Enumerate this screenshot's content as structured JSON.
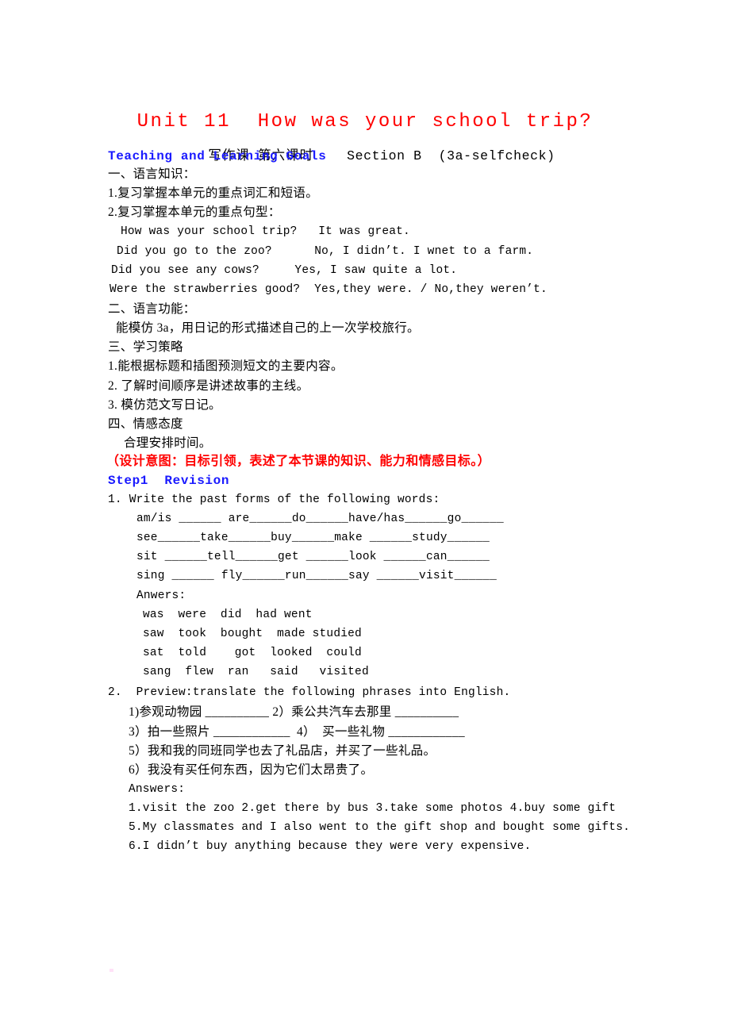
{
  "document": {
    "title": "Unit 11  How was your school trip?",
    "subtitle_cn": "写作课  第六课时",
    "subtitle_en": "Section B  (3a-selfcheck)",
    "colors": {
      "title_red": "#ff0000",
      "heading_blue": "#1a1aff",
      "design_intent_red": "#ff0000",
      "body_black": "#000000",
      "page_background": "#ffffff"
    }
  },
  "goals": {
    "heading": "Teaching and Learning Goals",
    "section_one_title": "一、语言知识：",
    "item_1": "1.复习掌握本单元的重点词汇和短语。",
    "item_2": "2.复习掌握本单元的重点句型：",
    "sentence_1": "How was your school trip?   It was great.",
    "sentence_2": "Did you go to the zoo?      No, I didn’t. I wnet to a farm.",
    "sentence_3": "Did you see any cows?     Yes, I saw quite a lot.",
    "sentence_4": "Were the strawberries good?  Yes,they were. / No,they weren’t.",
    "section_two_title": "二、语言功能：",
    "section_two_body": "能模仿 3a，用日记的形式描述自己的上一次学校旅行。",
    "section_three_title": "三、学习策略",
    "strategy_1": "1.能根据标题和插图预测短文的主要内容。",
    "strategy_2": "2. 了解时间顺序是讲述故事的主线。",
    "strategy_3": "3. 模仿范文写日记。",
    "section_four_title": "四、情感态度",
    "section_four_body": "合理安排时间。",
    "design_intent": "（设计意图：目标引领，表述了本节课的知识、能力和情感目标。）"
  },
  "step1": {
    "heading": "Step1  Revision",
    "task1": {
      "prompt": "1. Write the past forms of the following words:",
      "row_1": "am/is ______ are______do______have/has______go______",
      "row_2": "see______take______buy______make ______study______",
      "row_3": "sit ______tell______get ______look ______can______",
      "row_4": "sing ______ fly______run______say ______visit______",
      "answers_label": "Anwers:",
      "answer_row_1": "was  were  did  had went",
      "answer_row_2": "saw  took  bought  made studied",
      "answer_row_3": "sat  told    got  looked  could",
      "answer_row_4": "sang  flew  ran   said   visited"
    },
    "task2": {
      "prompt": "2.  Preview:translate the following phrases into English.",
      "phrase_1_2": "1)参观动物园 __________ 2）乘公共汽车去那里 __________",
      "phrase_3_4": "3）拍一些照片 ____________  4）  买一些礼物 ____________",
      "phrase_5": "5）我和我的同班同学也去了礼品店，并买了一些礼品。",
      "phrase_6": "6）我没有买任何东西，因为它们太昂贵了。",
      "answers_label": "Answers:",
      "answer_row_1": "1.visit the zoo 2.get there by bus 3.take some photos 4.buy some gift",
      "answer_row_2": "5.My classmates and I also went to the gift shop and bought some gifts.",
      "answer_row_3": "6.I didn’t buy anything because they were very expensive."
    }
  }
}
